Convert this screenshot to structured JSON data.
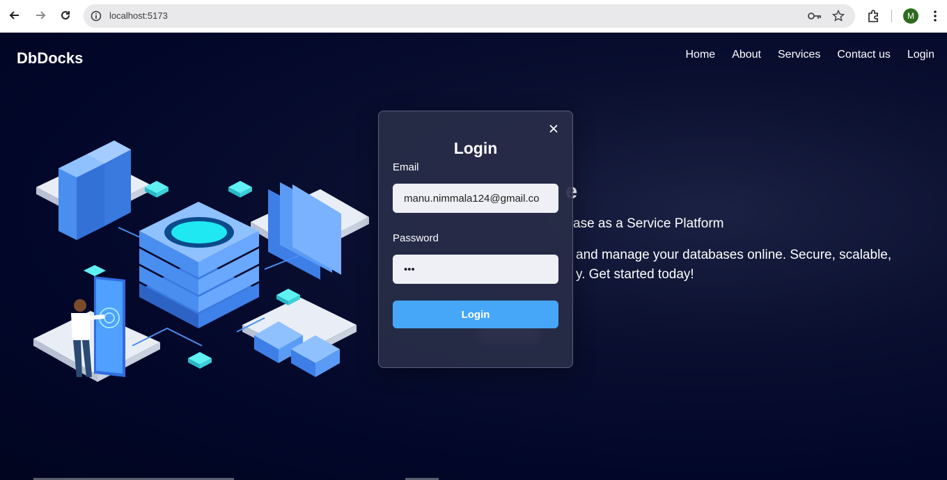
{
  "browser": {
    "url": "localhost:5173",
    "profile_initial": "M",
    "icons": [
      "back-icon",
      "forward-icon",
      "reload-icon",
      "info-icon",
      "password-key-icon",
      "star-icon",
      "extensions-icon",
      "kebab-menu-icon"
    ]
  },
  "header": {
    "logo": "DbDocks",
    "nav": [
      {
        "label": "Home"
      },
      {
        "label": "About"
      },
      {
        "label": "Services"
      },
      {
        "label": "Contact us"
      },
      {
        "label": "Login"
      }
    ]
  },
  "hero": {
    "title_visible": "e",
    "subtitle_visible": "ase as a Service Platform",
    "description_line1_visible": "and manage your databases online. Secure, scalable,",
    "description_line2_visible": "y. Get started today!"
  },
  "modal": {
    "title": "Login",
    "email_label": "Email",
    "email_value": "manu.nimmala124@gmail.co",
    "password_label": "Password",
    "password_value": "•••",
    "submit_label": "Login"
  },
  "colors": {
    "page_bg": "#02072a",
    "accent": "#46a6f8",
    "modal_bg": "#282c48"
  }
}
